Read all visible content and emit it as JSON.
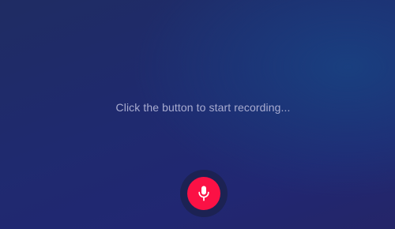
{
  "status": {
    "text": "Click the button to start recording..."
  },
  "record_button": {
    "icon": "microphone-icon",
    "color": "#fb1145",
    "ring_color": "#1c2253"
  },
  "theme": {
    "background_start": "#1f2c63",
    "background_end": "#242568",
    "text_color": "#a9acd0"
  }
}
